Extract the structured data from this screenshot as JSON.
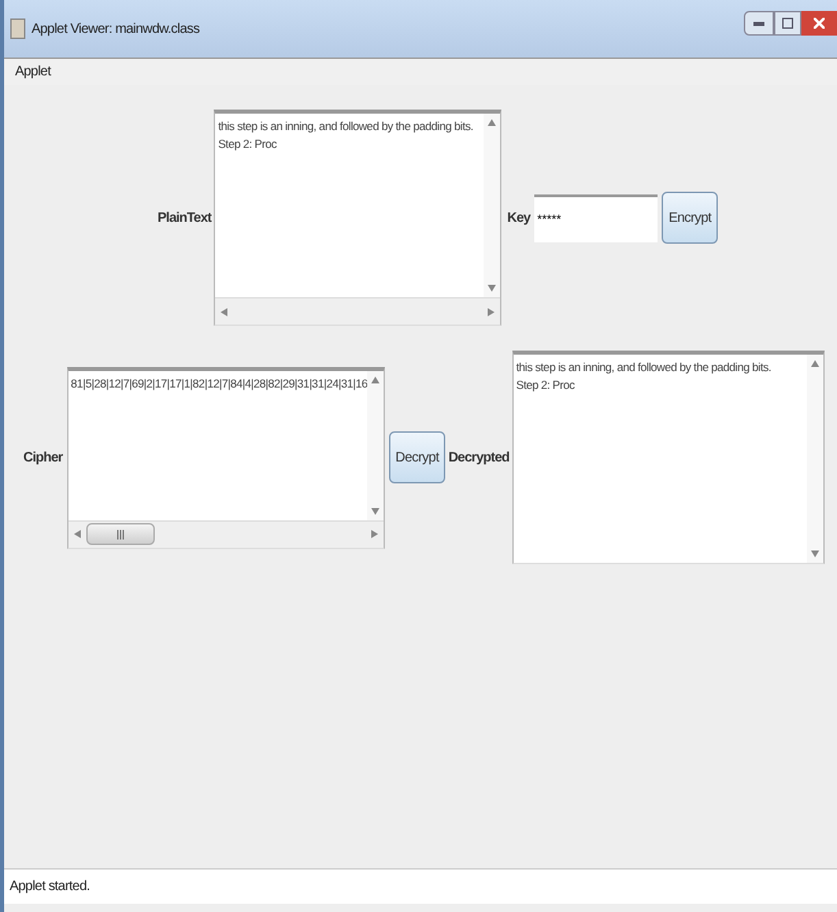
{
  "window": {
    "title": "Applet Viewer: mainwdw.class"
  },
  "menu": [
    "Applet"
  ],
  "plaintext": {
    "label": "PlainText",
    "lines": [
      "this step is an inning, and followed by the padding bits.",
      "Step 2: Proc"
    ]
  },
  "key": {
    "label": "Key",
    "value": "*****"
  },
  "encrypt_button": "Encrypt",
  "cipher": {
    "label": "Cipher",
    "lines": [
      "81|5|28|12|7|69|2|17|17|1|82|12|7|84|4|28|82|29|31|31|24|31|16"
    ]
  },
  "decrypt_button": "Decrypt",
  "decrypted": {
    "label": "Decrypted",
    "lines": [
      "this step is an inning, and followed by the padding bits.",
      "Step 2: Proc"
    ]
  },
  "status_bar": "Applet started."
}
